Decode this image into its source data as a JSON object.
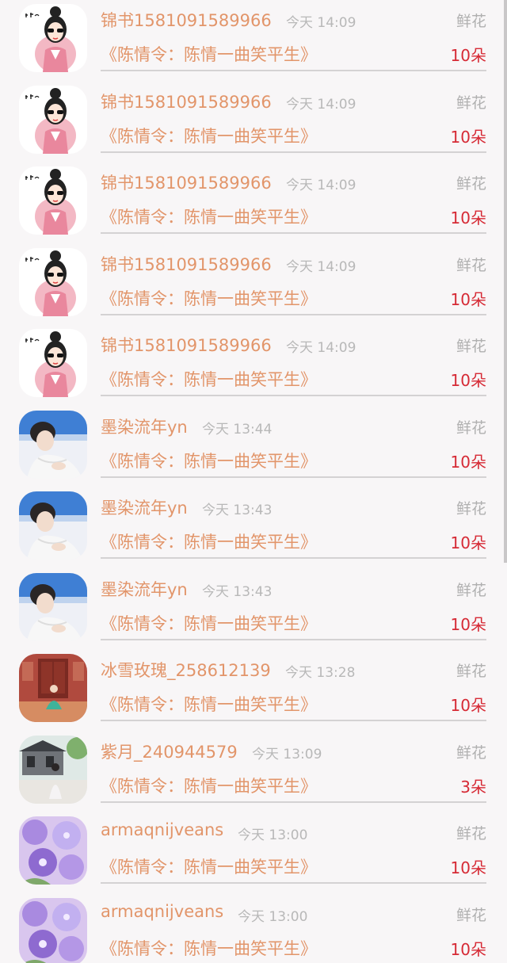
{
  "colors": {
    "name": "#e2956a",
    "time": "#b8b8b8",
    "category": "#b0b0b0",
    "count": "#d62a35",
    "divider": "#d4d2d3",
    "background": "#f8f6f7"
  },
  "rows": [
    {
      "avatar": "cartoon-girl",
      "name": "锦书1581091589966",
      "time": "今天 14:09",
      "category": "鲜花",
      "book": "《陈情令：陈情一曲笑平生》",
      "count": "10朵"
    },
    {
      "avatar": "cartoon-girl",
      "name": "锦书1581091589966",
      "time": "今天 14:09",
      "category": "鲜花",
      "book": "《陈情令：陈情一曲笑平生》",
      "count": "10朵"
    },
    {
      "avatar": "cartoon-girl",
      "name": "锦书1581091589966",
      "time": "今天 14:09",
      "category": "鲜花",
      "book": "《陈情令：陈情一曲笑平生》",
      "count": "10朵"
    },
    {
      "avatar": "cartoon-girl",
      "name": "锦书1581091589966",
      "time": "今天 14:09",
      "category": "鲜花",
      "book": "《陈情令：陈情一曲笑平生》",
      "count": "10朵"
    },
    {
      "avatar": "cartoon-girl",
      "name": "锦书1581091589966",
      "time": "今天 14:09",
      "category": "鲜花",
      "book": "《陈情令：陈情一曲笑平生》",
      "count": "10朵"
    },
    {
      "avatar": "young-man-photo",
      "name": "墨染流年yn",
      "time": "今天 13:44",
      "category": "鲜花",
      "book": "《陈情令：陈情一曲笑平生》",
      "count": "10朵"
    },
    {
      "avatar": "young-man-photo",
      "name": "墨染流年yn",
      "time": "今天 13:43",
      "category": "鲜花",
      "book": "《陈情令：陈情一曲笑平生》",
      "count": "10朵"
    },
    {
      "avatar": "young-man-photo",
      "name": "墨染流年yn",
      "time": "今天 13:43",
      "category": "鲜花",
      "book": "《陈情令：陈情一曲笑平生》",
      "count": "10朵"
    },
    {
      "avatar": "girl-red-door-photo",
      "name": "冰雪玫瑰_258612139",
      "time": "今天 13:28",
      "category": "鲜花",
      "book": "《陈情令：陈情一曲笑平生》",
      "count": "10朵"
    },
    {
      "avatar": "girl-garden-photo",
      "name": "紫月_240944579",
      "time": "今天 13:09",
      "category": "鲜花",
      "book": "《陈情令：陈情一曲笑平生》",
      "count": "3朵"
    },
    {
      "avatar": "purple-flowers-photo",
      "name": "armaqnijveans",
      "time": "今天 13:00",
      "category": "鲜花",
      "book": "《陈情令：陈情一曲笑平生》",
      "count": "10朵"
    },
    {
      "avatar": "purple-flowers-photo",
      "name": "armaqnijveans",
      "time": "今天 13:00",
      "category": "鲜花",
      "book": "《陈情令：陈情一曲笑平生》",
      "count": "10朵"
    }
  ]
}
